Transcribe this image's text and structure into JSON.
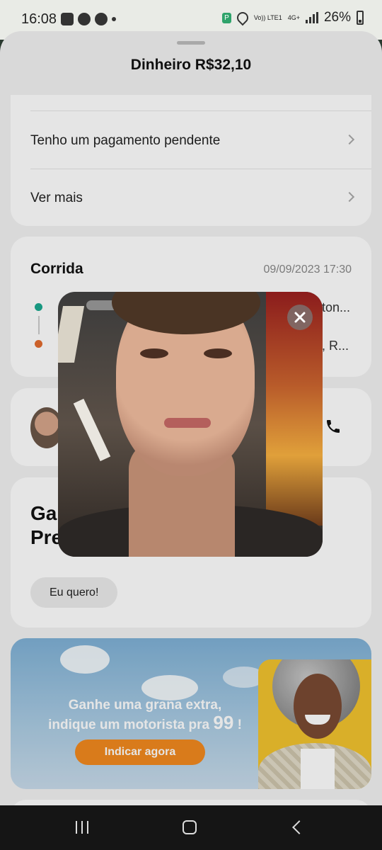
{
  "status_bar": {
    "time": "16:08",
    "battery": "26%",
    "network": "4G+",
    "carrier_label": "Vo)) LTE1",
    "notification_icons": [
      "parking-app-icon",
      "whatsapp-icon",
      "chrome-icon"
    ]
  },
  "sheet": {
    "title": "Dinheiro R$32,10",
    "links": [
      {
        "label": "Tenho um pagamento pendente"
      },
      {
        "label": "Ver mais"
      }
    ]
  },
  "ride": {
    "title": "Corrida",
    "date": "09/09/2023 17:30",
    "origin_text_fragment": "ton...",
    "destination_text_fragment": ", R...",
    "origin_color": "#1aa98f",
    "destination_color": "#e36b2e"
  },
  "promo": {
    "title_visible": "Ga Pre",
    "title_line1": "Ga",
    "title_line2": "Pre",
    "button_label": "Eu quero!"
  },
  "banner": {
    "line1": "Ganhe uma grana extra,",
    "line2": "indique um motorista pra",
    "number": "99",
    "suffix": "!",
    "button_label": "Indicar agora",
    "button_color": "#f28a1f"
  },
  "photo_modal": {
    "image": "driver-photo"
  }
}
